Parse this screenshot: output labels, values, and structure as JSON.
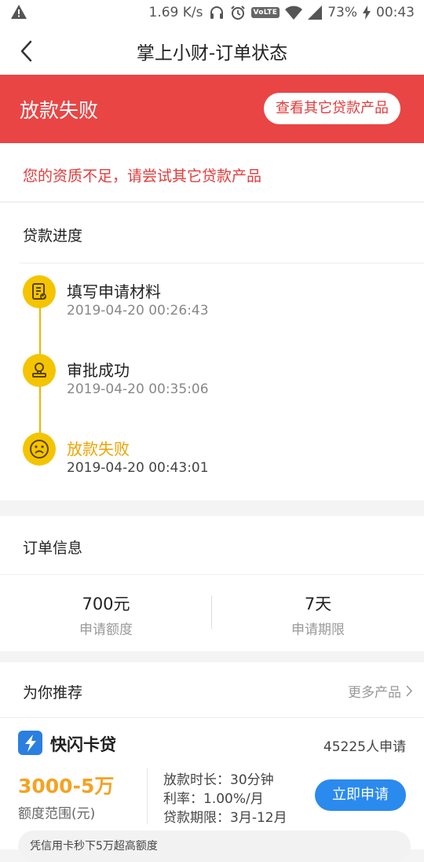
{
  "statusbar": {
    "speed": "1.69 K/s",
    "volte": "VoLTE",
    "battery": "73%",
    "time": "00:43",
    "icons": [
      "warning-icon",
      "headphones-icon",
      "alarm-icon",
      "volte-icon",
      "wifi-icon",
      "signal-icon",
      "charging-icon"
    ]
  },
  "nav": {
    "title": "掌上小财-订单状态",
    "back_icon": "back-arrow-icon"
  },
  "banner": {
    "status": "放款失败",
    "button": "查看其它贷款产品",
    "color": "#e94545"
  },
  "reason": "您的资质不足，请尝试其它贷款产品",
  "progress": {
    "title": "贷款进度",
    "steps": [
      {
        "name": "填写申请材料",
        "time": "2019-04-20 00:26:43",
        "icon": "document-check-icon"
      },
      {
        "name": "审批成功",
        "time": "2019-04-20 00:35:06",
        "icon": "stamp-icon"
      },
      {
        "name": "放款失败",
        "time": "2019-04-20 00:43:01",
        "icon": "sad-face-icon"
      }
    ],
    "accent": "#f5c400"
  },
  "order": {
    "title": "订单信息",
    "amount_value": "700元",
    "amount_label": "申请额度",
    "term_value": "7天",
    "term_label": "申请期限"
  },
  "recommend": {
    "title": "为你推荐",
    "more": "更多产品",
    "product": {
      "name": "快闪卡贷",
      "applicants": "45225人申请",
      "amount": "3000-5万",
      "amount_label": "额度范围(元)",
      "details": [
        "放款时长：30分钟",
        "利率：1.00%/月",
        "贷款期限：3月-12月"
      ],
      "apply": "立即申请",
      "promo": "凭信用卡秒下5万超高额度"
    }
  }
}
